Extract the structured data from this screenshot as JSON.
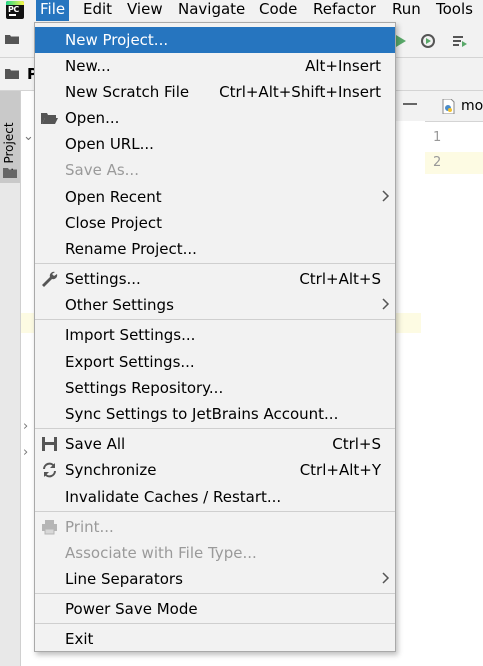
{
  "menubar": {
    "logo_text": "PC",
    "items": [
      "File",
      "Edit",
      "View",
      "Navigate",
      "Code",
      "Refactor",
      "Run",
      "Tools"
    ],
    "active": "File"
  },
  "project_row": {
    "label": "P"
  },
  "side_panel": {
    "tab_label": "1: Project"
  },
  "editor": {
    "tab_label": "mo",
    "line_numbers": [
      "1",
      "2"
    ]
  },
  "file_menu": {
    "items": [
      {
        "label": "New Project...",
        "shortcut": "",
        "selected": true
      },
      {
        "label": "New...",
        "shortcut": "Alt+Insert"
      },
      {
        "label": "New Scratch File",
        "shortcut": "Ctrl+Alt+Shift+Insert"
      },
      {
        "label": "Open...",
        "shortcut": "",
        "icon": "folder-open-icon"
      },
      {
        "label": "Open URL...",
        "shortcut": ""
      },
      {
        "label": "Save As...",
        "shortcut": "",
        "disabled": true
      },
      {
        "label": "Open Recent",
        "shortcut": "",
        "submenu": true
      },
      {
        "label": "Close Project",
        "shortcut": ""
      },
      {
        "label": "Rename Project...",
        "shortcut": ""
      },
      {
        "label": "Settings...",
        "shortcut": "Ctrl+Alt+S",
        "icon": "wrench-icon"
      },
      {
        "label": "Other Settings",
        "shortcut": "",
        "submenu": true
      },
      {
        "label": "Import Settings...",
        "shortcut": ""
      },
      {
        "label": "Export Settings...",
        "shortcut": ""
      },
      {
        "label": "Settings Repository...",
        "shortcut": ""
      },
      {
        "label": "Sync Settings to JetBrains Account...",
        "shortcut": ""
      },
      {
        "label": "Save All",
        "shortcut": "Ctrl+S",
        "icon": "save-icon"
      },
      {
        "label": "Synchronize",
        "shortcut": "Ctrl+Alt+Y",
        "icon": "sync-icon"
      },
      {
        "label": "Invalidate Caches / Restart...",
        "shortcut": ""
      },
      {
        "label": "Print...",
        "shortcut": "",
        "disabled": true,
        "icon": "printer-icon"
      },
      {
        "label": "Associate with File Type...",
        "shortcut": "",
        "disabled": true
      },
      {
        "label": "Line Separators",
        "shortcut": "",
        "submenu": true
      },
      {
        "label": "Power Save Mode",
        "shortcut": ""
      },
      {
        "label": "Exit",
        "shortcut": ""
      }
    ]
  },
  "colors": {
    "selection": "#2675bf",
    "menu_bg": "#f2f2f2",
    "disabled_text": "#9a9a9a",
    "current_line": "#fdfbe3"
  }
}
